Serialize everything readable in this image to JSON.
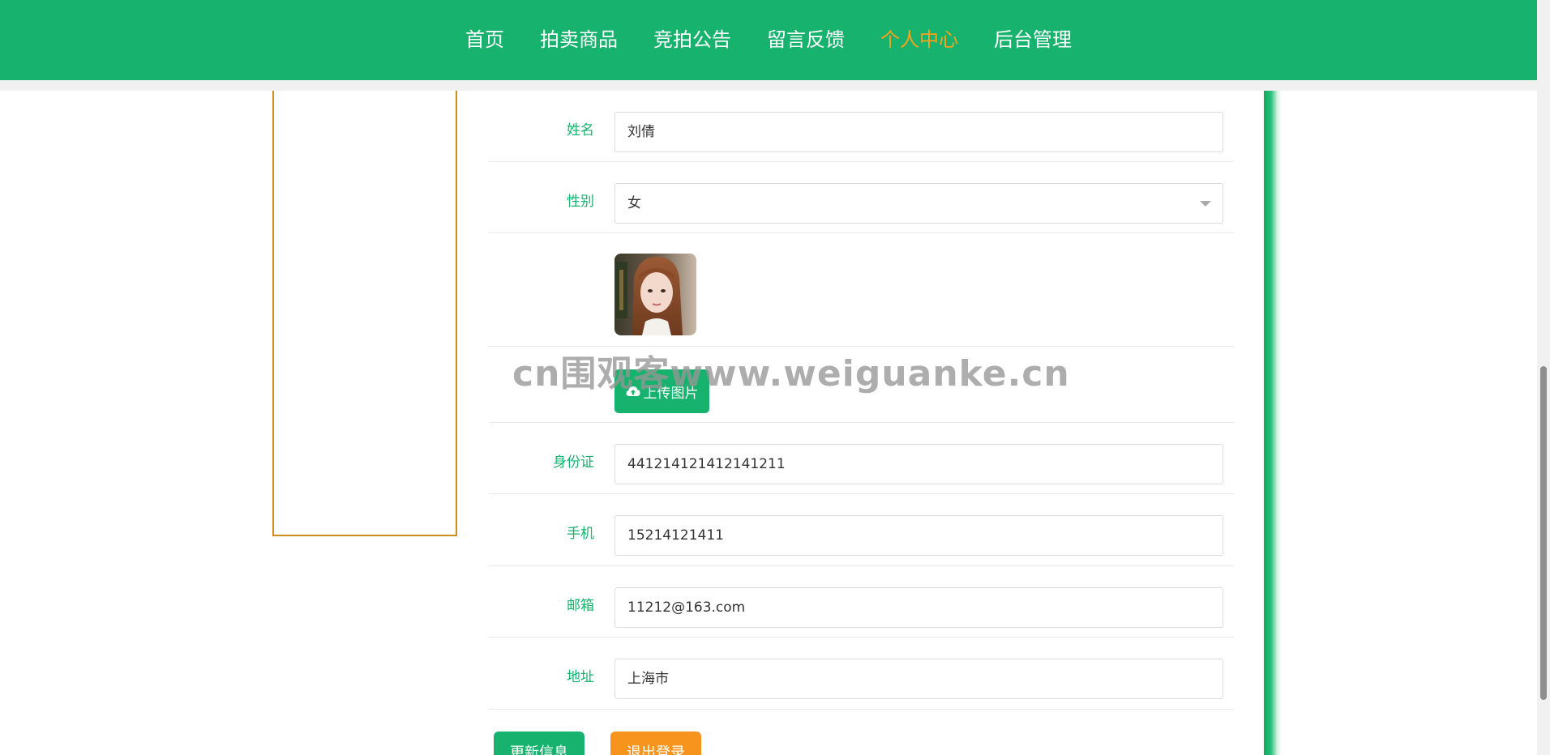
{
  "nav": {
    "items": [
      {
        "label": "首页",
        "active": false
      },
      {
        "label": "拍卖商品",
        "active": false
      },
      {
        "label": "竞拍公告",
        "active": false
      },
      {
        "label": "留言反馈",
        "active": false
      },
      {
        "label": "个人中心",
        "active": true
      },
      {
        "label": "后台管理",
        "active": false
      }
    ],
    "active_color": "#f7a21b"
  },
  "form": {
    "name": {
      "label": "姓名",
      "value": "刘倩"
    },
    "gender": {
      "label": "性别",
      "value": "女"
    },
    "upload_label": "上传图片",
    "id_card": {
      "label": "身份证",
      "value": "441214121412141211"
    },
    "phone": {
      "label": "手机",
      "value": "15214121411"
    },
    "email": {
      "label": "邮箱",
      "value": "11212@163.com"
    },
    "address": {
      "label": "地址",
      "value": "上海市"
    }
  },
  "buttons": {
    "update": "更新信息",
    "logout": "退出登录"
  },
  "watermark": "cn围观客www.weiguanke.cn",
  "colors": {
    "brand_green": "#17b26d",
    "accent_orange": "#f7941d",
    "panel_border": "#d08d1f"
  }
}
